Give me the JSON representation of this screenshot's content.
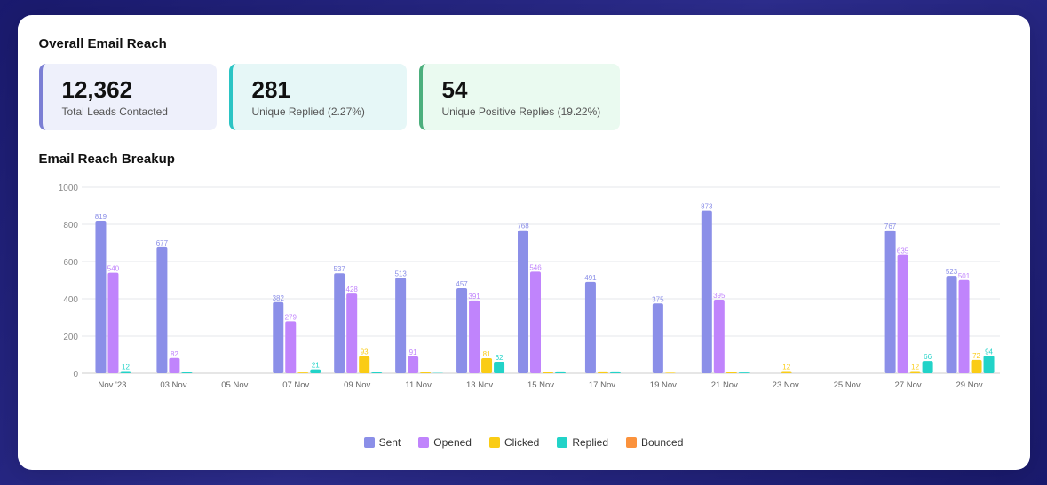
{
  "title": "Overall Email Reach",
  "stats": [
    {
      "id": "total-leads",
      "value": "12,362",
      "label": "Total Leads Contacted",
      "style": "blue"
    },
    {
      "id": "unique-replied",
      "value": "281",
      "label": "Unique Replied (2.27%)",
      "style": "teal"
    },
    {
      "id": "unique-positive",
      "value": "54",
      "label": "Unique Positive Replies (19.22%)",
      "style": "green"
    }
  ],
  "breakup_title": "Email Reach Breakup",
  "chart": {
    "yMax": 1000,
    "yLabels": [
      0,
      200,
      400,
      600,
      800,
      1000
    ],
    "xLabels": [
      "Nov '23",
      "03 Nov",
      "05 Nov",
      "07 Nov",
      "09 Nov",
      "11 Nov",
      "13 Nov",
      "15 Nov",
      "17 Nov",
      "19 Nov",
      "21 Nov",
      "23 Nov",
      "25 Nov",
      "27 Nov",
      "29 Nov"
    ],
    "bars": [
      {
        "label": "Nov '23",
        "sent": 819,
        "opened": 540,
        "clicked": 0,
        "replied": 12,
        "bounced": 0
      },
      {
        "label": "03 Nov",
        "sent": 677,
        "opened": 82,
        "clicked": 0,
        "replied": 8,
        "bounced": 0
      },
      {
        "label": "05 Nov",
        "sent": 0,
        "opened": 0,
        "clicked": 0,
        "replied": 0,
        "bounced": 0
      },
      {
        "label": "07 Nov",
        "sent": 382,
        "opened": 279,
        "clicked": 4,
        "replied": 21,
        "bounced": 0
      },
      {
        "label": "09 Nov",
        "sent": 537,
        "opened": 428,
        "clicked": 93,
        "replied": 5,
        "bounced": 0
      },
      {
        "label": "11 Nov",
        "sent": 513,
        "opened": 91,
        "clicked": 9,
        "replied": 2,
        "bounced": 0
      },
      {
        "label": "13 Nov",
        "sent": 457,
        "opened": 391,
        "clicked": 81,
        "replied": 62,
        "bounced": 0
      },
      {
        "label": "15 Nov",
        "sent": 768,
        "opened": 546,
        "clicked": 8,
        "replied": 10,
        "bounced": 0
      },
      {
        "label": "17 Nov",
        "sent": 491,
        "opened": 0,
        "clicked": 10,
        "replied": 10,
        "bounced": 0
      },
      {
        "label": "19 Nov",
        "sent": 375,
        "opened": 0,
        "clicked": 3,
        "replied": 0,
        "bounced": 0
      },
      {
        "label": "21 Nov",
        "sent": 873,
        "opened": 395,
        "clicked": 7,
        "replied": 4,
        "bounced": 0
      },
      {
        "label": "23 Nov",
        "sent": 0,
        "opened": 0,
        "clicked": 12,
        "replied": 0,
        "bounced": 0
      },
      {
        "label": "25 Nov",
        "sent": 0,
        "opened": 0,
        "clicked": 0,
        "replied": 0,
        "bounced": 0
      },
      {
        "label": "27 Nov",
        "sent": 767,
        "opened": 635,
        "clicked": 12,
        "replied": 66,
        "bounced": 0
      },
      {
        "label": "29 Nov",
        "sent": 523,
        "opened": 501,
        "clicked": 72,
        "replied": 94,
        "bounced": 0
      }
    ]
  },
  "legend": [
    {
      "key": "sent",
      "label": "Sent",
      "color": "#8b8fe8"
    },
    {
      "key": "opened",
      "label": "Opened",
      "color": "#c084fc"
    },
    {
      "key": "clicked",
      "label": "Clicked",
      "color": "#facc15"
    },
    {
      "key": "replied",
      "label": "Replied",
      "color": "#22d3c8"
    },
    {
      "key": "bounced",
      "label": "Bounced",
      "color": "#fb923c"
    }
  ]
}
